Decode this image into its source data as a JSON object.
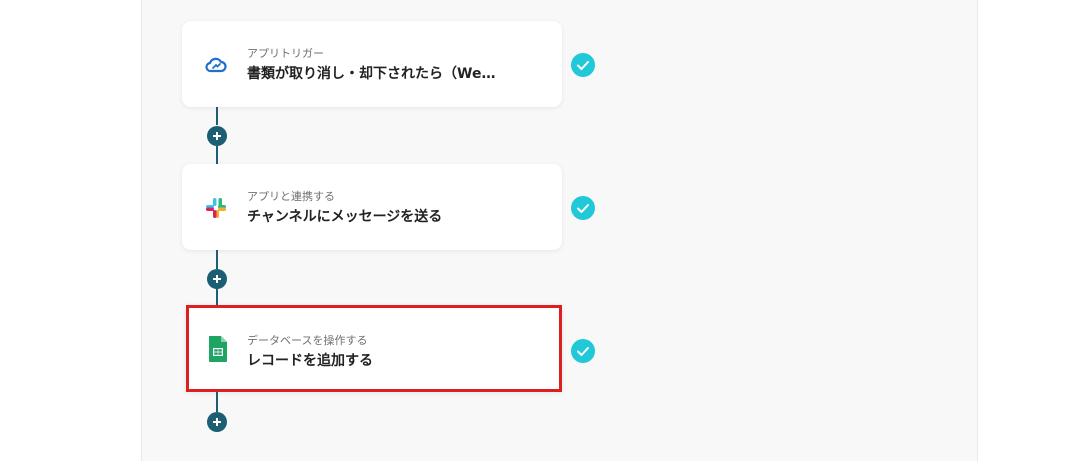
{
  "flow": {
    "steps": [
      {
        "subtitle": "アプリトリガー",
        "title": "書類が取り消し・却下されたら（We…",
        "icon": "cloud-sign-icon",
        "status": "complete"
      },
      {
        "subtitle": "アプリと連携する",
        "title": "チャンネルにメッセージを送る",
        "icon": "slack-icon",
        "status": "complete"
      },
      {
        "subtitle": "データベースを操作する",
        "title": "レコードを追加する",
        "icon": "google-sheets-icon",
        "status": "complete",
        "highlighted": true
      }
    ]
  },
  "colors": {
    "connector": "#1d5f72",
    "check": "#20c8d8",
    "highlight": "#dd1f1f",
    "canvas": "#f8f8f8"
  }
}
